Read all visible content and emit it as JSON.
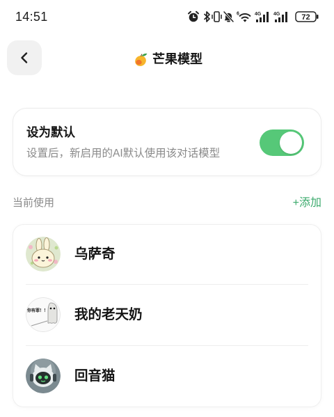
{
  "status_bar": {
    "time": "14:51",
    "wifi_badge": "6",
    "network_labels": [
      "4G",
      "4G"
    ],
    "battery": "72",
    "icons": [
      "alarm-clock-icon",
      "bluetooth-icon",
      "vibrate-icon",
      "bell-off-icon",
      "wifi-icon",
      "signal-icon",
      "signal-icon",
      "battery-icon"
    ]
  },
  "header": {
    "back_icon": "chevron-left-icon",
    "title_icon": "mango-icon",
    "title": "芒果模型"
  },
  "default_setting": {
    "title": "设为默认",
    "description": "设置后，新启用的AI默认使用该对话模型",
    "toggle_on": true
  },
  "current_section": {
    "label": "当前使用",
    "add_label": "+添加"
  },
  "characters": [
    {
      "name": "乌萨奇",
      "avatar": "bunny-avatar"
    },
    {
      "name": "我的老天奶",
      "avatar": "ghost-avatar",
      "avatar_text": "你有罪！！"
    },
    {
      "name": "回音猫",
      "avatar": "robot-cat-avatar"
    }
  ],
  "colors": {
    "accent_green": "#56c878",
    "add_link": "#3caa6d",
    "secondary_text": "#8a8a8a",
    "back_button_bg": "#f1f1f1"
  }
}
